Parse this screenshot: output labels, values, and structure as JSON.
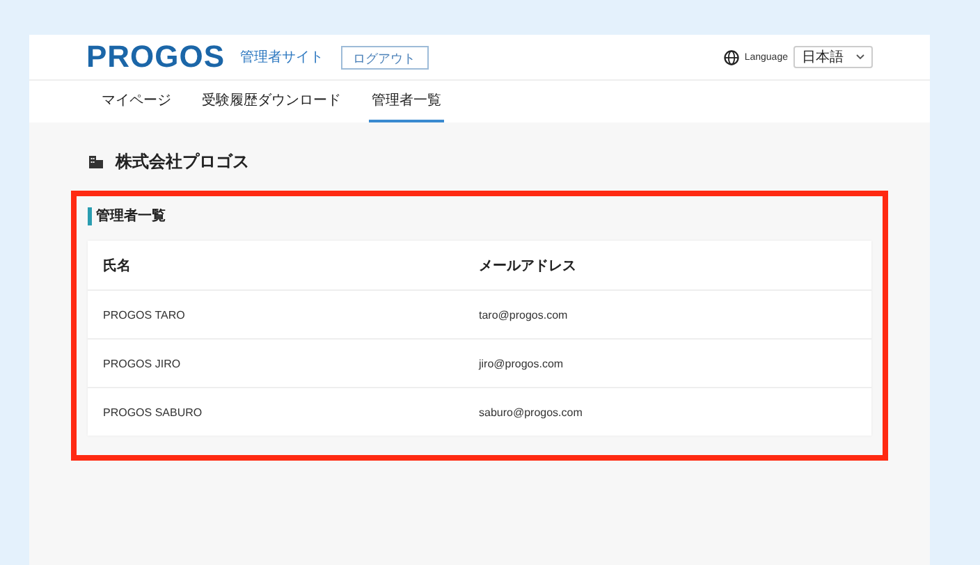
{
  "header": {
    "logo": "PROGOS",
    "site_label": "管理者サイト",
    "logout_button": "ログアウト",
    "language_label": "Language",
    "language_value": "日本語"
  },
  "nav": [
    {
      "label": "マイページ",
      "selected": false
    },
    {
      "label": "受験履歴ダウンロード",
      "selected": false
    },
    {
      "label": "管理者一覧",
      "selected": true
    }
  ],
  "company_name": "株式会社プロゴス",
  "admin_section": {
    "title": "管理者一覧",
    "highlighted": true,
    "table": {
      "columns": [
        "氏名",
        "メールアドレス"
      ],
      "rows": [
        [
          "PROGOS TARO",
          "taro@progos.com"
        ],
        [
          "PROGOS JIRO",
          "jiro@progos.com"
        ],
        [
          "PROGOS SABURO",
          "saburo@progos.com"
        ]
      ]
    }
  }
}
